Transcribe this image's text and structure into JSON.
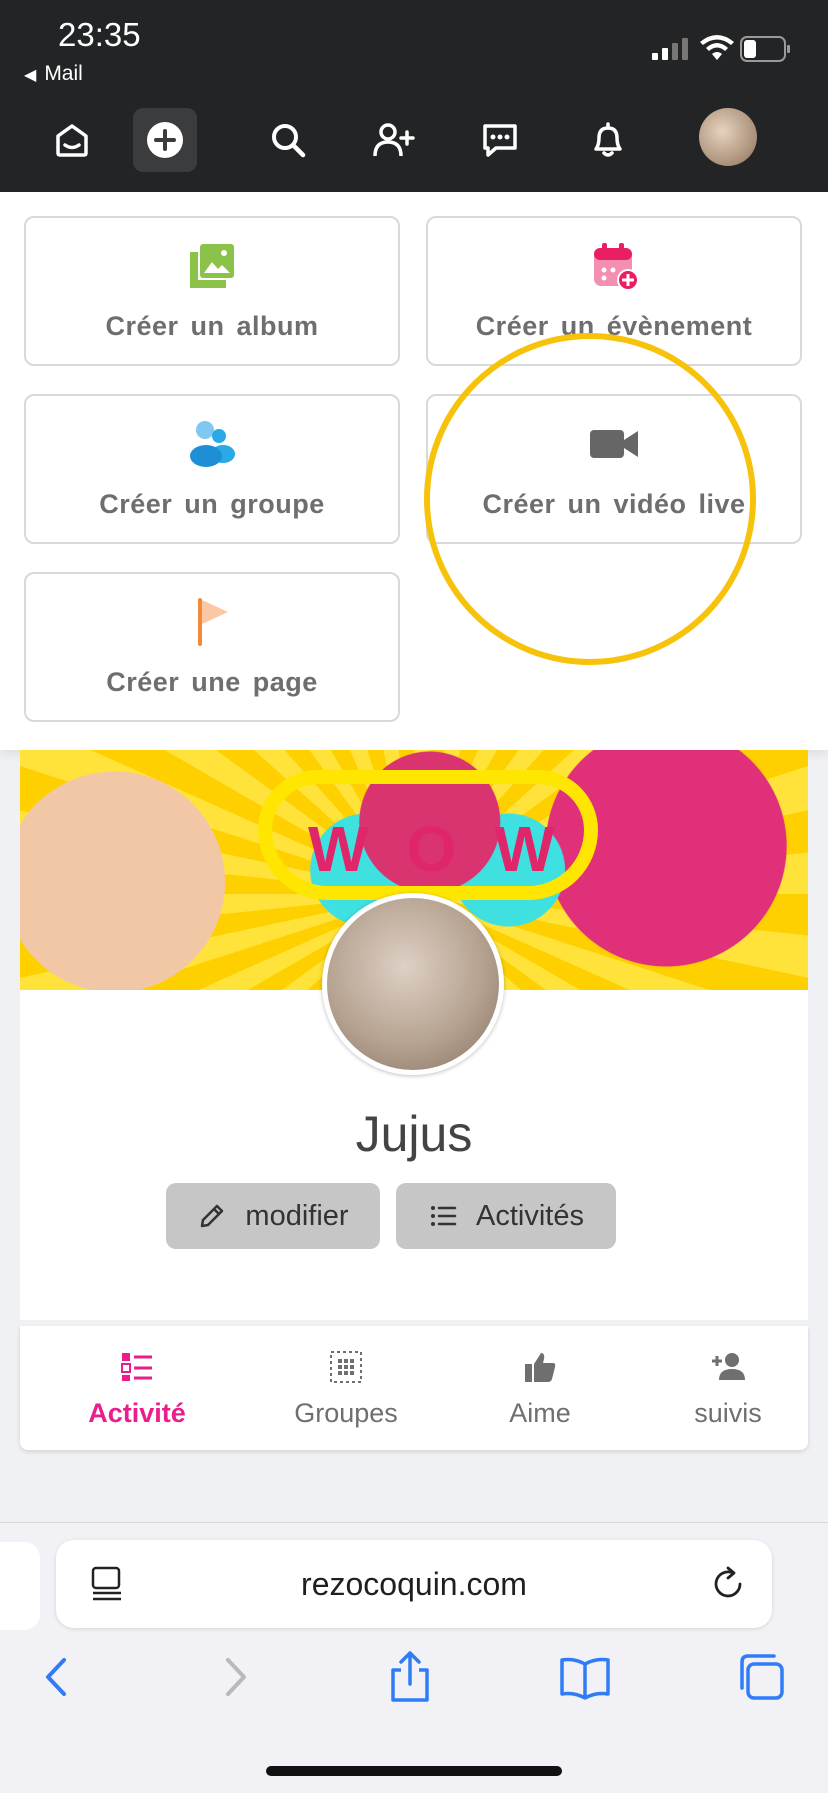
{
  "status_bar": {
    "time": "23:35",
    "back_app": "Mail"
  },
  "nav": {
    "icons": [
      "home-icon",
      "add-circle-icon",
      "search-icon",
      "add-friend-icon",
      "messages-icon",
      "bell-icon"
    ]
  },
  "create_menu": {
    "items": [
      {
        "label": "Créer un album",
        "icon": "image-icon",
        "color": "#8bc34a"
      },
      {
        "label": "Créer un évènement",
        "icon": "calendar-plus-icon",
        "color": "#e91e63"
      },
      {
        "label": "Créer un groupe",
        "icon": "group-icon",
        "color": "#29a9e8"
      },
      {
        "label": "Créer un vidéo live",
        "icon": "video-camera-icon",
        "color": "#666666"
      },
      {
        "label": "Créer une page",
        "icon": "flag-icon",
        "color": "#f7a26b"
      }
    ],
    "highlight_color": "#f7c20a"
  },
  "profile": {
    "name": "Jujus",
    "cover_text": "WOW",
    "edit_label": "modifier",
    "activities_label": "Activités"
  },
  "tabs": [
    {
      "label": "Activité",
      "active": true
    },
    {
      "label": "Groupes",
      "active": false
    },
    {
      "label": "Aime",
      "active": false
    },
    {
      "label": "suivis",
      "active": false
    }
  ],
  "browser": {
    "url": "rezocoquin.com"
  },
  "colors": {
    "accent": "#e91e8c",
    "topbar": "#222425",
    "safari_blue": "#2f7cf6"
  }
}
